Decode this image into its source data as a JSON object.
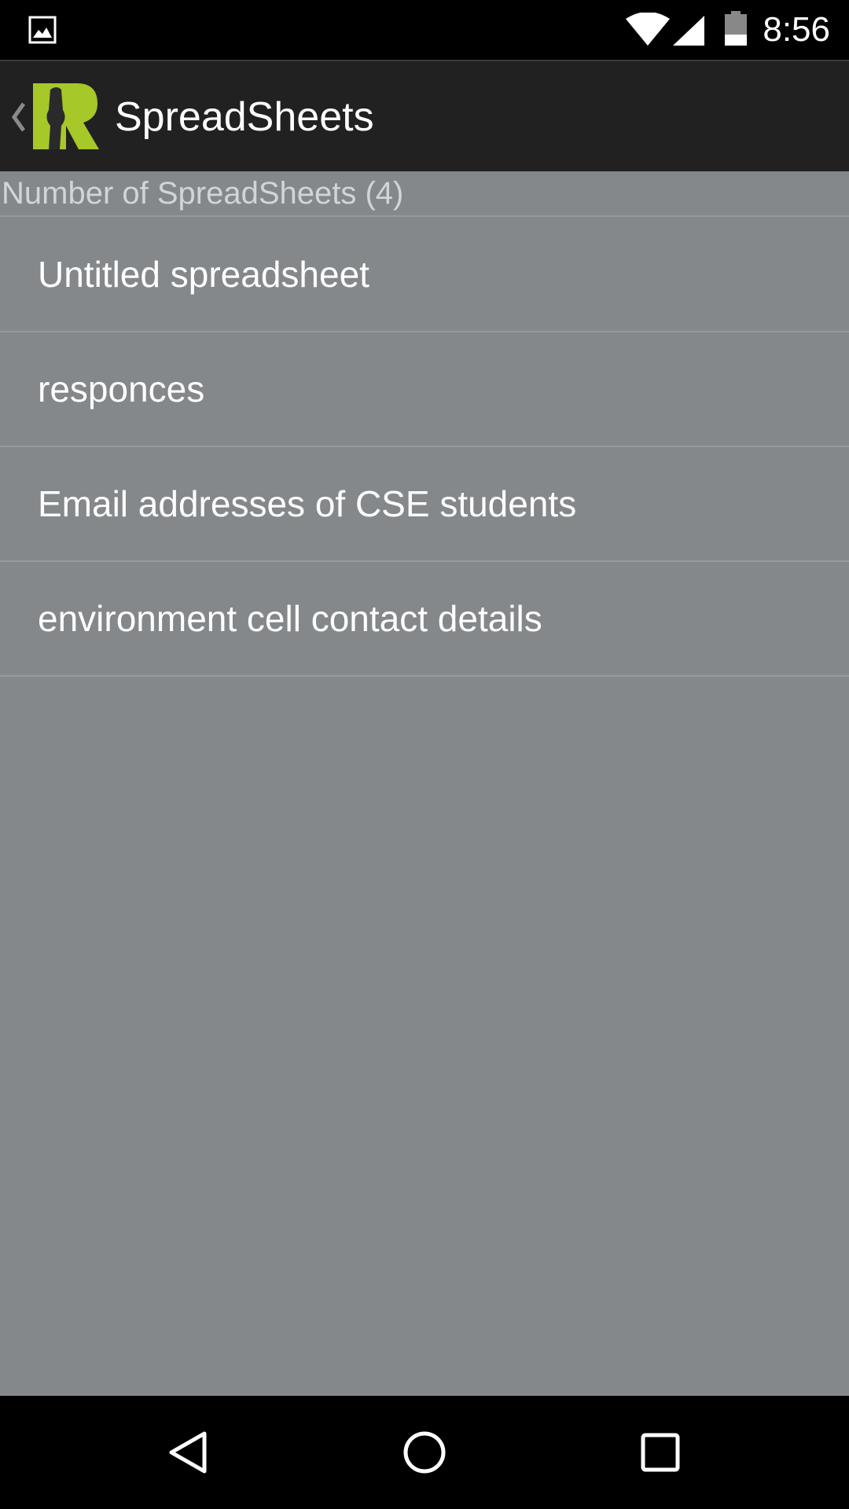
{
  "status_bar": {
    "time": "8:56",
    "icons": [
      "gallery-icon",
      "wifi-icon",
      "signal-icon",
      "battery-icon"
    ]
  },
  "action_bar": {
    "title": "SpreadSheets",
    "logo_color": "#a6c828"
  },
  "section_header": {
    "label": "Number of SpreadSheets (4)"
  },
  "spreadsheets": [
    {
      "name": "Untitled spreadsheet"
    },
    {
      "name": "responces"
    },
    {
      "name": "Email addresses of CSE students"
    },
    {
      "name": "environment cell contact details"
    }
  ],
  "nav_bar": {
    "icons": [
      "back-icon",
      "home-icon",
      "recents-icon"
    ]
  },
  "colors": {
    "background": "#84888b",
    "action_bar": "#212121",
    "status_bar": "#000000",
    "divider": "#969a9d"
  }
}
